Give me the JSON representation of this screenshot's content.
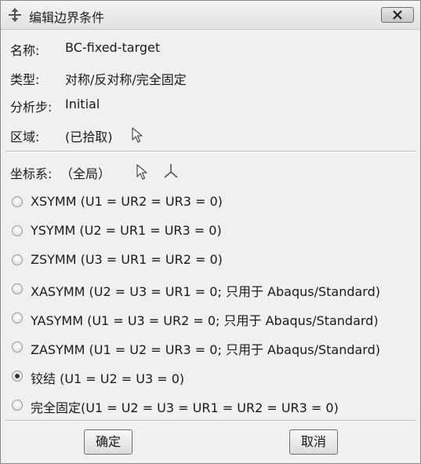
{
  "window": {
    "title": "编辑边界条件",
    "icons": {
      "app": "move-arrows-icon",
      "close": "close-icon"
    }
  },
  "fields": {
    "name_label": "名称:",
    "name_value": "BC-fixed-target",
    "type_label": "类型:",
    "type_value": "对称/反对称/完全固定",
    "step_label": "分析步:",
    "step_value": "Initial",
    "region_label": "区域:",
    "region_value": "(已拾取)",
    "region_icon": "pointer-arrow-icon"
  },
  "csys": {
    "label": "坐标系:",
    "value": "（全局）",
    "icons": [
      "pointer-arrow-icon",
      "csys-triad-icon"
    ]
  },
  "options": [
    {
      "label": "XSYMM (U1 = UR2 = UR3 = 0)",
      "selected": false
    },
    {
      "label": "YSYMM (U2 = UR1 = UR3 = 0)",
      "selected": false
    },
    {
      "label": "ZSYMM (U3 = UR1 = UR2 = 0)",
      "selected": false
    },
    {
      "label": "XASYMM (U2 = U3 = UR1 = 0; 只用于 Abaqus/Standard)",
      "selected": false
    },
    {
      "label": "YASYMM (U1 = U3 = UR2 = 0; 只用于 Abaqus/Standard)",
      "selected": false
    },
    {
      "label": "ZASYMM (U1 = U2 = UR3 = 0; 只用于 Abaqus/Standard)",
      "selected": false
    },
    {
      "label": "铰结 (U1 = U2 = U3 = 0)",
      "selected": true
    },
    {
      "label": "完全固定(U1 = U2 = U3 = UR1 = UR2 = UR3 = 0)",
      "selected": false
    }
  ],
  "buttons": {
    "ok": "确定",
    "cancel": "取消"
  }
}
